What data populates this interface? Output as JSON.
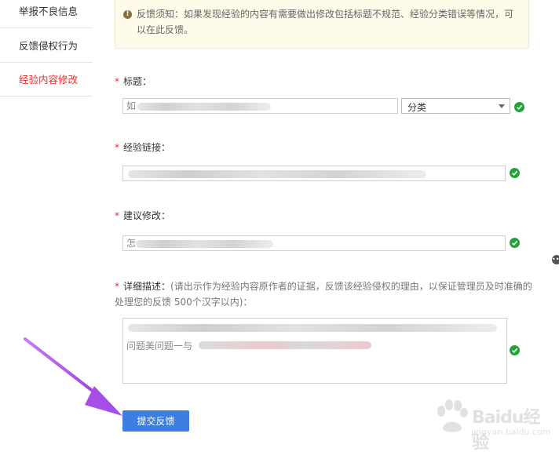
{
  "sidebar": {
    "items": [
      {
        "label": "举报不良信息",
        "active": false
      },
      {
        "label": "反馈侵权行为",
        "active": false
      },
      {
        "label": "经验内容修改",
        "active": true
      }
    ]
  },
  "notice": {
    "text": "反馈须知：如果发现经验的内容有需要做出修改包括标题不规范、经验分类错误等情况，可以在此反馈。"
  },
  "form": {
    "required_mark": "*",
    "title_label": "标题：",
    "title_value_prefix": "如",
    "category_select": "分类",
    "link_label": "经验链接：",
    "suggest_label": "建议修改：",
    "suggest_value_prefix": "怎",
    "detail_label": "详细描述：",
    "detail_hint": "(请出示作为经验内容原作者的证据，反馈该经验侵权的理由，以保证管理员及时准确的处理您的反馈 500个汉字以内)：",
    "detail_value_line2": "问题美问题一与",
    "submit_label": "提交反馈"
  },
  "watermark": {
    "brand": "Baidu经验",
    "url": "jingyan.baidu.com"
  },
  "colors": {
    "required": "#e02f2f",
    "active_link": "#e02f2f",
    "submit_bg": "#3c7fe0",
    "success": "#21a33a",
    "notice_bg": "#fffbea",
    "annotation_arrow": "#a64ee8"
  },
  "icons": {
    "notice": "info-icon",
    "valid": "check-circle-icon",
    "select": "chevron-down-icon",
    "annotation": "arrow-icon"
  }
}
